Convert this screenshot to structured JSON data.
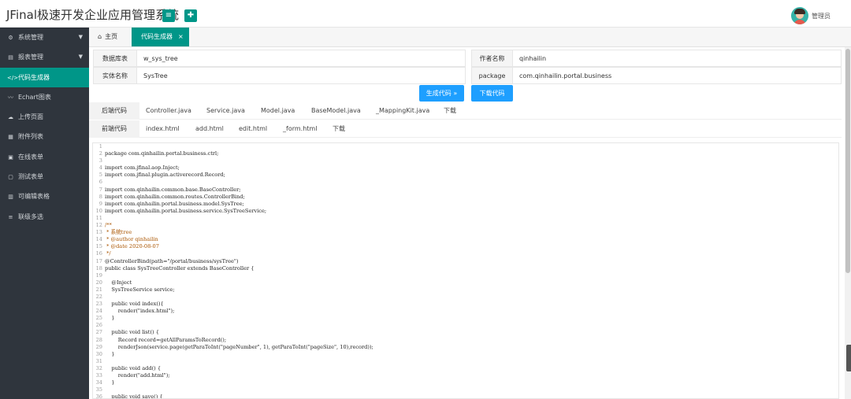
{
  "header": {
    "title": "JFinal极速开发企业应用管理系统",
    "menu_button_icon": "menu-icon",
    "refresh_button_icon": "refresh-icon",
    "username": "管理员"
  },
  "sidebar": {
    "items": [
      {
        "label": "系统管理",
        "icon": "gear-icon",
        "expandable": true,
        "active": false
      },
      {
        "label": "报表管理",
        "icon": "report-icon",
        "expandable": true,
        "active": false
      },
      {
        "label": "代码生成器",
        "icon": "code-icon",
        "expandable": false,
        "active": true
      },
      {
        "label": "Echart图表",
        "icon": "chart-icon",
        "expandable": false,
        "active": false
      },
      {
        "label": "上传页面",
        "icon": "upload-icon",
        "expandable": false,
        "active": false
      },
      {
        "label": "附件列表",
        "icon": "attachment-icon",
        "expandable": false,
        "active": false
      },
      {
        "label": "在线表单",
        "icon": "form-icon",
        "expandable": false,
        "active": false
      },
      {
        "label": "测试表单",
        "icon": "test-form-icon",
        "expandable": false,
        "active": false
      },
      {
        "label": "可编辑表格",
        "icon": "table-icon",
        "expandable": false,
        "active": false
      },
      {
        "label": "联级多选",
        "icon": "cascade-icon",
        "expandable": false,
        "active": false
      }
    ]
  },
  "tabs": {
    "home": "主页",
    "active": "代码生成器",
    "close": "×"
  },
  "form": {
    "db_table_label": "数据库表",
    "db_table_value": "w_sys_tree",
    "author_label": "作者名称",
    "author_value": "qinhailin",
    "entity_label": "实体名称",
    "entity_value": "SysTree",
    "package_label": "package",
    "package_value": "com.qinhailin.portal.business",
    "generate_button": "生成代码 »",
    "download_button": "下载代码"
  },
  "backend_tabs": [
    "后端代码",
    "Controller.java",
    "Service.java",
    "Model.java",
    "BaseModel.java",
    "_MappingKit.java",
    "下载"
  ],
  "frontend_tabs": [
    "前端代码",
    "index.html",
    "add.html",
    "edit.html",
    "_form.html",
    "下载"
  ],
  "code_lines": [
    "",
    "package com.qinhailin.portal.business.ctrl;",
    "",
    "import com.jfinal.aop.Inject;",
    "import com.jfinal.plugin.activerecord.Record;",
    "",
    "import com.qinhailin.common.base.BaseController;",
    "import com.qinhailin.common.routes.ControllerBind;",
    "import com.qinhailin.portal.business.model.SysTree;",
    "import com.qinhailin.portal.business.service.SysTreeService;",
    "",
    "/**",
    " * 系统tree",
    " * @author qinhailin",
    " * @date 2020-08-07",
    " */",
    "@ControllerBind(path=\"/portal/business/sysTree\")",
    "public class SysTreeController extends BaseController {",
    "",
    "    @Inject",
    "    SysTreeService service;",
    "",
    "    public void index(){",
    "        render(\"index.html\");",
    "    }",
    "",
    "    public void list() {",
    "        Record record=getAllParamsToRecord();",
    "        renderJson(service.page(getParaToInt(\"pageNumber\", 1), getParaToInt(\"pageSize\", 10),record));",
    "    }",
    "",
    "    public void add() {",
    "        render(\"add.html\");",
    "    }",
    "",
    "    public void save() {"
  ],
  "colors": {
    "primary": "#009688",
    "blue": "#1e9fff",
    "sidebar": "#2f353d",
    "code_package": "#3355cc",
    "code_string": "#c41a16",
    "code_comment": "#aa5500"
  }
}
